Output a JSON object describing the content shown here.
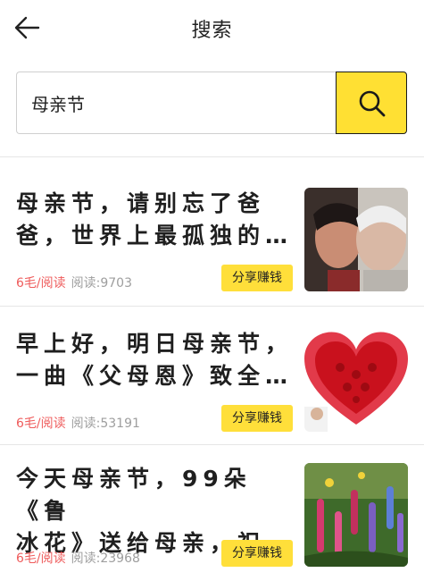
{
  "header": {
    "title": "搜索",
    "back_icon": "arrow-left-icon"
  },
  "search": {
    "value": "母亲节",
    "button_icon": "search-icon"
  },
  "colors": {
    "accent_yellow": "#ffe033",
    "price_red": "#ef5c5c",
    "muted_gray": "#9e9e9e"
  },
  "articles": [
    {
      "title": "母亲节，请别忘了爸\n爸，世界上最孤独的…",
      "price": "6毛/阅读",
      "reads": "阅读:9703",
      "share_label": "分享赚钱",
      "thumb": "elderly-people-photo"
    },
    {
      "title": "早上好，明日母亲节，\n一曲《父母恩》致全…",
      "price": "6毛/阅读",
      "reads": "阅读:53191",
      "share_label": "分享赚钱",
      "thumb": "carnation-heart-photo"
    },
    {
      "title": "今天母亲节，99朵《鲁\n冰花》送给母亲，祝…",
      "price": "6毛/阅读",
      "reads": "阅读:23968",
      "share_label": "分享赚钱",
      "thumb": "lupine-flowers-photo"
    }
  ]
}
